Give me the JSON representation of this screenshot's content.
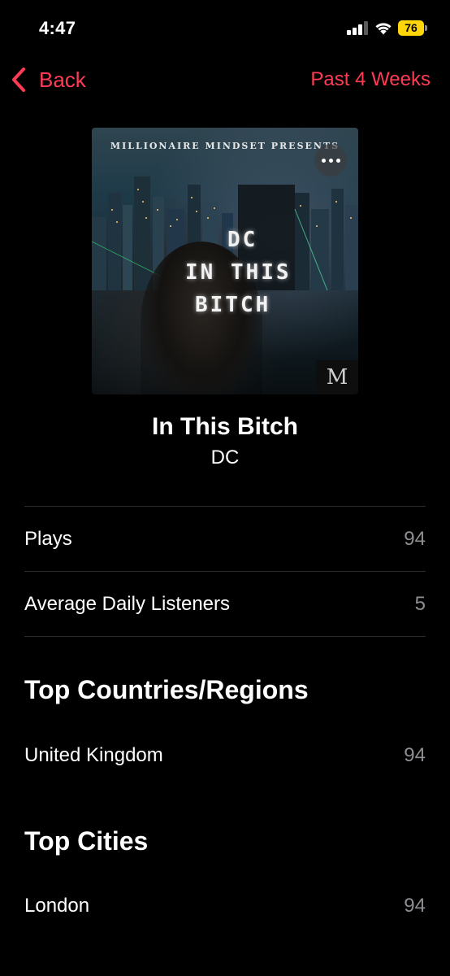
{
  "status_bar": {
    "time": "4:47",
    "battery": "76"
  },
  "nav": {
    "back_label": "Back",
    "period_label": "Past 4 Weeks"
  },
  "artwork": {
    "top_text": "MILLIONAIRE MINDSET PRESENTS",
    "title_lines": [
      "DC",
      "IN THIS",
      "BITCH"
    ],
    "logo_letter": "M"
  },
  "song": {
    "title": "In This Bitch",
    "artist": "DC"
  },
  "stats": {
    "plays": {
      "label": "Plays",
      "value": "94"
    },
    "listeners": {
      "label": "Average Daily Listeners",
      "value": "5"
    }
  },
  "countries": {
    "heading": "Top Countries/Regions",
    "items": [
      {
        "label": "United Kingdom",
        "value": "94"
      }
    ]
  },
  "cities": {
    "heading": "Top Cities",
    "items": [
      {
        "label": "London",
        "value": "94"
      }
    ]
  },
  "colors": {
    "accent": "#fe3b55",
    "background": "#000000",
    "secondary_text": "#8e8e93"
  }
}
